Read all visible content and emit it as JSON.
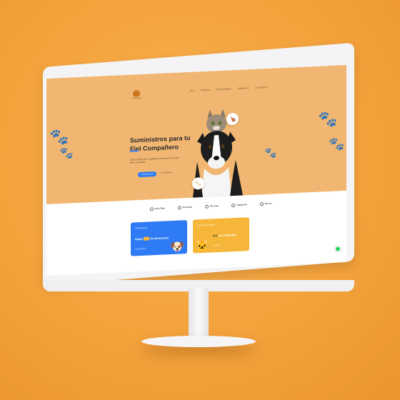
{
  "nav": {
    "logo_text": "PetShop",
    "items": [
      "Inicio",
      "Productos",
      "Más Populares",
      "Testimonios",
      "Contáctanos"
    ]
  },
  "hero": {
    "title_line1": "Suministros para tu",
    "title_word_accent": "Fiel",
    "title_line2_rest": " Compañero",
    "subtitle": "Lleva lo mejor de compañías veraces para una vida feliz y saludable.",
    "cta_primary": "Comprar Ahora",
    "cta_secondary": "Ver Productos"
  },
  "brands": [
    "Cat's Play",
    "Fur Paws",
    "Pet Care",
    "Happy Pet",
    "Pet Co"
  ],
  "cards": [
    {
      "tag": "Oferta Especial",
      "text_a": "Hasta",
      "text_b": "de descuento",
      "link": "Comprar Ahora →"
    },
    {
      "tag": "Regalo de Bienvenida",
      "text_a": "2x1",
      "text_b": "en croquetas",
      "link": "Ver Promo →"
    }
  ],
  "colors": {
    "accent": "#2f7bf5",
    "hero_bg": "#f1b772",
    "page_bg": "#f3a23c",
    "whatsapp": "#25d366"
  },
  "icons": [
    "paw-icon",
    "whatsapp-icon"
  ]
}
